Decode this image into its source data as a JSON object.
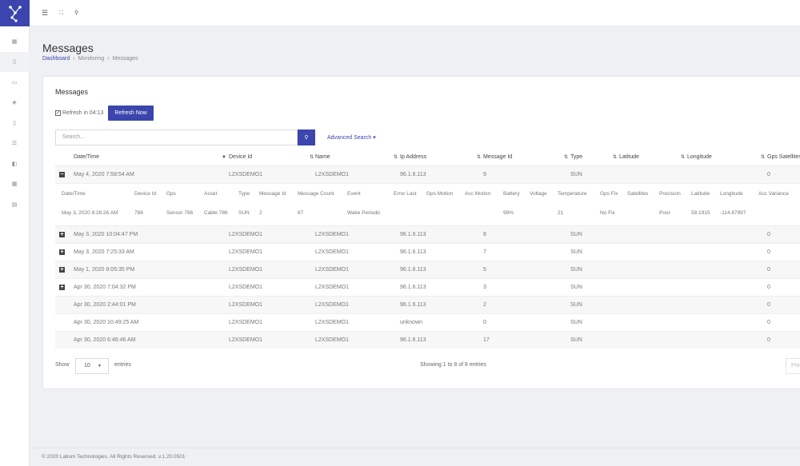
{
  "topbar": {
    "icons": [
      "menu-icon",
      "fullscreen-icon",
      "search-icon"
    ]
  },
  "sidebar": {
    "items": [
      "grid-icon",
      "phone-icon",
      "map-icon",
      "shield-icon",
      "mobile-icon",
      "list-icon",
      "layers-icon",
      "sliders-icon",
      "table-icon"
    ]
  },
  "page": {
    "title": "Messages",
    "breadcrumb": [
      "Dashboard",
      "Monitoring",
      "Messages"
    ]
  },
  "card": {
    "title": "Messages",
    "refresh_label": "Refresh in 04:13",
    "refresh_checked": true,
    "refresh_button": "Refresh Now",
    "search_placeholder": "Search...",
    "advanced_search": "Advanced Search ▾"
  },
  "table": {
    "columns": [
      "Date/Time",
      "Device Id",
      "Name",
      "Ip Address",
      "Message Id",
      "Type",
      "Latitude",
      "Longitude",
      "Gps Satellites"
    ],
    "rows": [
      {
        "date": "May 4, 2020 7:58:54 AM",
        "device": "L2XSDEMO1",
        "name": "L2XSDEMO1",
        "ip": "96.1.6.113",
        "msg": "9",
        "type": "SUN",
        "sats": "0",
        "expander": "−"
      },
      {
        "date": "May 3, 2020 10:04:47 PM",
        "device": "L2XSDEMO1",
        "name": "L2XSDEMO1",
        "ip": "96.1.6.113",
        "msg": "8",
        "type": "SUN",
        "sats": "0",
        "expander": "+"
      },
      {
        "date": "May 3, 2020 7:25:33 AM",
        "device": "L2XSDEMO1",
        "name": "L2XSDEMO1",
        "ip": "96.1.6.113",
        "msg": "7",
        "type": "SUN",
        "sats": "0",
        "expander": "+"
      },
      {
        "date": "May 1, 2020 8:05:35 PM",
        "device": "L2XSDEMO1",
        "name": "L2XSDEMO1",
        "ip": "96.1.6.113",
        "msg": "5",
        "type": "SUN",
        "sats": "0",
        "expander": "+"
      },
      {
        "date": "Apr 30, 2020 7:04:32 PM",
        "device": "L2XSDEMO1",
        "name": "L2XSDEMO1",
        "ip": "96.1.6.113",
        "msg": "3",
        "type": "SUN",
        "sats": "0",
        "expander": "+"
      },
      {
        "date": "Apr 30, 2020 2:44:01 PM",
        "device": "L2XSDEMO1",
        "name": "L2XSDEMO1",
        "ip": "96.1.6.113",
        "msg": "2",
        "type": "SUN",
        "sats": "0",
        "expander": ""
      },
      {
        "date": "Apr 30, 2020 10:49:25 AM",
        "device": "L2XSDEMO1",
        "name": "L2XSDEMO1",
        "ip": "unknown",
        "msg": "0",
        "type": "SUN",
        "sats": "0",
        "expander": ""
      },
      {
        "date": "Apr 30, 2020 6:46:46 AM",
        "device": "L2XSDEMO1",
        "name": "L2XSDEMO1",
        "ip": "96.1.6.113",
        "msg": "17",
        "type": "SUN",
        "sats": "0",
        "expander": ""
      }
    ],
    "detail": {
      "headers": [
        "Date/Time",
        "Device Id",
        "Gps",
        "Asset",
        "Type",
        "Message Id",
        "Message Count",
        "Event",
        "Error Last",
        "Gps Motion",
        "Acc Motion",
        "Battery",
        "Voltage",
        "Temperature",
        "Gps Fix",
        "Satellites",
        "Precision",
        "Latitude",
        "Longitude",
        "Acc Variance"
      ],
      "values": [
        "May 3, 2020 8:26:26 AM",
        "786",
        "Sensor 786",
        "Cable 786",
        "SUN",
        "2",
        "87",
        "Wake Periodic",
        "",
        "",
        "",
        "99%",
        "",
        "21",
        "No Fix",
        "",
        "Poor",
        "58.1915",
        "-114.87997",
        ""
      ]
    }
  },
  "footer": {
    "show": "Show",
    "page_length": "10",
    "entries": "entries",
    "info": "Showing 1 to 8 of 8 entries",
    "prev": "Pre",
    "copyright": "© 2020 Latium Technologies. All Rights Reserved. v.1.20.0501"
  }
}
